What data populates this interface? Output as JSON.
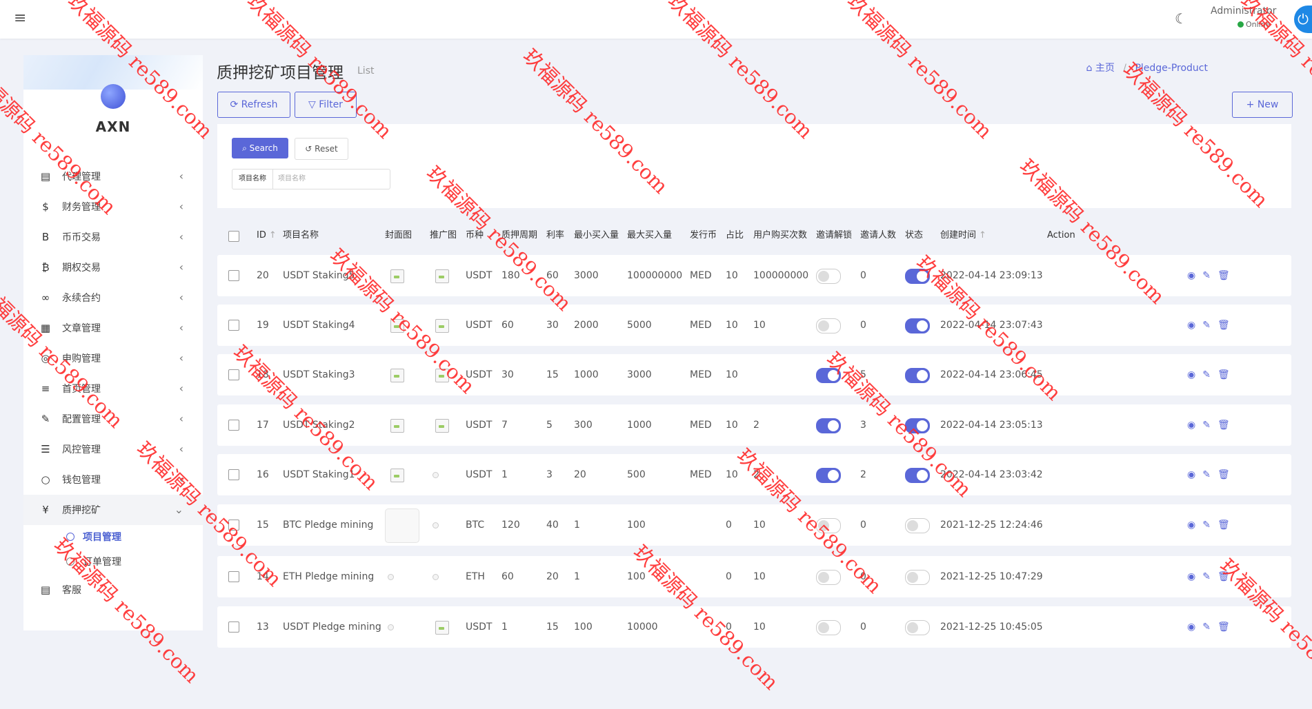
{
  "navbar": {
    "menu_icon": "hamburger-icon",
    "theme_icon": "moon-icon",
    "user": "Administrator",
    "status": "Online",
    "power_icon": "power-icon"
  },
  "sidebar": {
    "brand": "AXN",
    "items": [
      {
        "label": "代理管理",
        "icon": "id-card-icon",
        "glyph": "▤"
      },
      {
        "label": "财务管理",
        "icon": "dollar-icon",
        "glyph": "$"
      },
      {
        "label": "币币交易",
        "icon": "bitcoin-b-icon",
        "glyph": "B"
      },
      {
        "label": "期权交易",
        "icon": "bitcoin-icon",
        "glyph": "₿"
      },
      {
        "label": "永续合约",
        "icon": "link-icon",
        "glyph": "∞"
      },
      {
        "label": "文章管理",
        "icon": "newspaper-icon",
        "glyph": "▦"
      },
      {
        "label": "申购管理",
        "icon": "life-ring-icon",
        "glyph": "◎"
      },
      {
        "label": "首页管理",
        "icon": "list-icon",
        "glyph": "≡"
      },
      {
        "label": "配置管理",
        "icon": "wrench-icon",
        "glyph": "✎"
      },
      {
        "label": "风控管理",
        "icon": "list-ul-icon",
        "glyph": "☰"
      },
      {
        "label": "钱包管理",
        "icon": "circle-icon",
        "glyph": "○"
      },
      {
        "label": "质押挖矿",
        "icon": "yen-icon",
        "glyph": "¥"
      }
    ],
    "sub_items": [
      {
        "label": "项目管理"
      },
      {
        "label": "订单管理"
      }
    ],
    "last_item": {
      "label": "客服",
      "icon": "id-badge-icon",
      "glyph": "▤"
    }
  },
  "header": {
    "title": "质押挖矿项目管理",
    "subtitle": "List",
    "breadcrumb_home": "主页",
    "breadcrumb_current": "Pledge-Product",
    "refresh": "Refresh",
    "filter": "Filter",
    "new": "New"
  },
  "filter": {
    "search": "Search",
    "reset": "Reset",
    "field_label": "项目名称",
    "field_placeholder": "项目名称"
  },
  "table": {
    "columns": [
      "ID",
      "项目名称",
      "封面图",
      "推广图",
      "币种",
      "质押周期",
      "利率",
      "最小买入量",
      "最大买入量",
      "发行币",
      "占比",
      "用户购买次数",
      "邀请解锁",
      "邀请人数",
      "状态",
      "创建时间",
      "Action"
    ],
    "rows": [
      {
        "id": "20",
        "name": "USDT Staking5",
        "cover": "img",
        "promo": "img",
        "coin": "USDT",
        "period": "180",
        "rate": "60",
        "min": "3000",
        "max": "100000000",
        "issue": "MED",
        "ratio": "10",
        "times": "100000000",
        "unlock": false,
        "invites": "0",
        "status": true,
        "created": "2022-04-14 23:09:13"
      },
      {
        "id": "19",
        "name": "USDT Staking4",
        "cover": "img",
        "promo": "img",
        "coin": "USDT",
        "period": "60",
        "rate": "30",
        "min": "2000",
        "max": "5000",
        "issue": "MED",
        "ratio": "10",
        "times": "10",
        "unlock": false,
        "invites": "0",
        "status": true,
        "created": "2022-04-14 23:07:43"
      },
      {
        "id": "18",
        "name": "USDT Staking3",
        "cover": "img",
        "promo": "img",
        "coin": "USDT",
        "period": "30",
        "rate": "15",
        "min": "1000",
        "max": "3000",
        "issue": "MED",
        "ratio": "10",
        "times": "",
        "unlock": true,
        "invites": "5",
        "status": true,
        "created": "2022-04-14 23:06:45"
      },
      {
        "id": "17",
        "name": "USDT Staking2",
        "cover": "img",
        "promo": "img",
        "coin": "USDT",
        "period": "7",
        "rate": "5",
        "min": "300",
        "max": "1000",
        "issue": "MED",
        "ratio": "10",
        "times": "2",
        "unlock": true,
        "invites": "3",
        "status": true,
        "created": "2022-04-14 23:05:13"
      },
      {
        "id": "16",
        "name": "USDT Staking1",
        "cover": "img",
        "promo": "dot",
        "coin": "USDT",
        "period": "1",
        "rate": "3",
        "min": "20",
        "max": "500",
        "issue": "MED",
        "ratio": "10",
        "times": "2",
        "unlock": true,
        "invites": "2",
        "status": true,
        "created": "2022-04-14 23:03:42"
      },
      {
        "id": "15",
        "name": "BTC Pledge mining",
        "cover": "big",
        "promo": "dot",
        "coin": "BTC",
        "period": "120",
        "rate": "40",
        "min": "1",
        "max": "100",
        "issue": "",
        "ratio": "0",
        "times": "10",
        "unlock": false,
        "invites": "0",
        "status": false,
        "created": "2021-12-25 12:24:46"
      },
      {
        "id": "14",
        "name": "ETH Pledge mining",
        "cover": "dot",
        "promo": "dot",
        "coin": "ETH",
        "period": "60",
        "rate": "20",
        "min": "1",
        "max": "100",
        "issue": "",
        "ratio": "0",
        "times": "10",
        "unlock": false,
        "invites": "0",
        "status": false,
        "created": "2021-12-25 10:47:29"
      },
      {
        "id": "13",
        "name": "USDT Pledge mining",
        "cover": "dot",
        "promo": "img",
        "coin": "USDT",
        "period": "1",
        "rate": "15",
        "min": "100",
        "max": "10000",
        "issue": "",
        "ratio": "0",
        "times": "10",
        "unlock": false,
        "invites": "0",
        "status": false,
        "created": "2021-12-25 10:45:05"
      }
    ],
    "action_icons": [
      "eye-icon",
      "pencil-icon",
      "trash-icon"
    ]
  },
  "watermark": {
    "text": "玖福源码 re589.com"
  }
}
